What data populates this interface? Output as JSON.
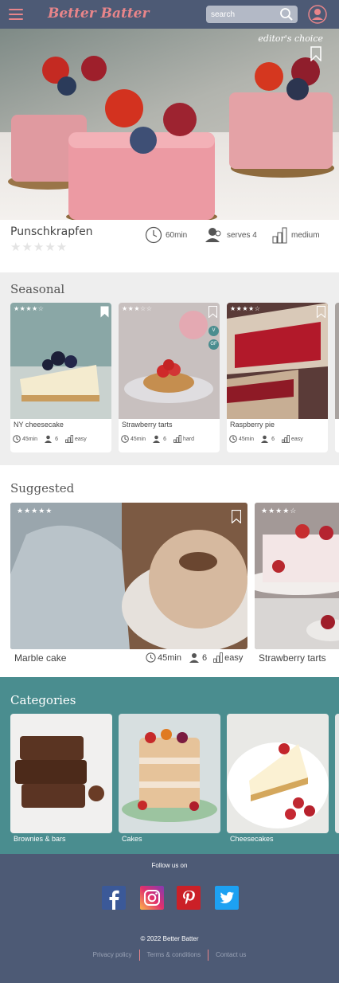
{
  "header": {
    "brand": "Better Batter",
    "search_placeholder": "search",
    "icons": [
      "menu-icon",
      "search-icon",
      "user-icon"
    ],
    "accent_color": "#e8858a",
    "bar_color": "#4d5a75"
  },
  "hero": {
    "badge": "editor's choice",
    "title": "Punschkrapfen",
    "rating": 0,
    "time": "60min",
    "serves": "serves 4",
    "difficulty": "medium"
  },
  "seasonal": {
    "title": "Seasonal",
    "cards": [
      {
        "name": "NY cheesecake",
        "stars": "★★★★☆",
        "time": "45min",
        "serves": "6",
        "difficulty": "easy"
      },
      {
        "name": "Strawberry  tarts",
        "stars": "★★★☆☆",
        "time": "45min",
        "serves": "6",
        "difficulty": "hard",
        "tags": [
          "V",
          "GF"
        ]
      },
      {
        "name": "Raspberry pie",
        "stars": "★★★★☆",
        "time": "45min",
        "serves": "6",
        "difficulty": "easy"
      }
    ]
  },
  "suggested": {
    "title": "Suggested",
    "cards": [
      {
        "name": "Marble cake",
        "stars": "★★★★★",
        "time": "45min",
        "serves": "6",
        "difficulty": "easy"
      },
      {
        "name": "Strawberry tarts",
        "stars": "★★★★☆"
      }
    ]
  },
  "categories": {
    "title": "Categories",
    "items": [
      "Brownies & bars",
      "Cakes",
      "Cheesecakes"
    ],
    "bg_color": "#4a8d8f"
  },
  "footer": {
    "follow": "Follow us on",
    "social": [
      "facebook-icon",
      "instagram-icon",
      "pinterest-icon",
      "twitter-icon"
    ],
    "copyright": "© 2022 Better Batter",
    "links": [
      "Privacy policy",
      "Terms & conditions",
      "Contact us"
    ]
  }
}
